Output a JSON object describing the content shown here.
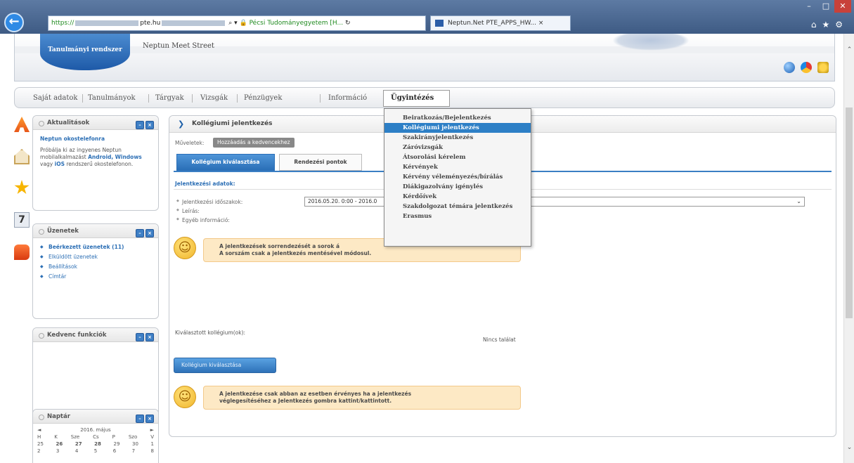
{
  "browser": {
    "address_prefix": "https://",
    "address_domain": "pte.hu",
    "address_cert": "Pécsi Tudományegyetem [H...",
    "tab_title": "Neptun.Net PTE_APPS_HW...",
    "tab_close": "×"
  },
  "header": {
    "logo_text": "Tanulmányi rendszer",
    "brand": "Neptun Meet Street"
  },
  "menu": {
    "items": [
      "Saját adatok",
      "Tanulmányok",
      "Tárgyak",
      "Vizsgák",
      "Pénzügyek",
      "Információ"
    ],
    "active": "Ügyintézés"
  },
  "dropdown": {
    "items": [
      "Beiratkozás/Bejelentkezés",
      "Kollégiumi jelentkezés",
      "Szakirányjelentkezés",
      "Záróvizsgák",
      "Átsorolási kérelem",
      "Kérvények",
      "Kérvény véleményezés/bírálás",
      "Diákigazolvány igénylés",
      "Kérdőívek",
      "Szakdolgozat témára jelentkezés",
      "Erasmus"
    ],
    "selected_index": 1
  },
  "sidebar": {
    "news": {
      "title": "Aktualitások",
      "headline": "Neptun okostelefonra",
      "body_1": "Próbálja ki az ingyenes Neptun mobilalkalmazást",
      "android": "Android,",
      "windows": "Windows",
      "body_2": "vagy",
      "ios": "iOS",
      "body_3": "rendszerű okostelefonon."
    },
    "messages": {
      "title": "Üzenetek",
      "inbox": "Beérkezett üzenetek (11)",
      "sent": "Elküldött üzenetek",
      "settings": "Beállítások",
      "contacts": "Címtár"
    },
    "favorites": {
      "title": "Kedvenc funkciók"
    },
    "calendar": {
      "title": "Naptár",
      "month": "2016. május",
      "prev": "◄",
      "next": "►",
      "weekdays": [
        "H",
        "K",
        "Sze",
        "Cs",
        "P",
        "Szo",
        "V"
      ],
      "row1": [
        "25",
        "26",
        "27",
        "28",
        "29",
        "30",
        "1"
      ],
      "row2": [
        "2",
        "3",
        "4",
        "5",
        "6",
        "7",
        "8"
      ]
    }
  },
  "main": {
    "title": "Kollégiumi jelentkezés",
    "ops_label": "Műveletek:",
    "ops_button": "Hozzáadás a kedvencekhez",
    "tab_active": "Kollégium kiválasztása",
    "tab_inactive": "Rendezési pontok",
    "section": "Jelentkezési adatok:",
    "field_period": "Jelentkezési időszakok:",
    "field_desc": "Leírás:",
    "field_info": "Egyéb információ:",
    "period_value": "2016.05.20. 0:00 - 2016.0",
    "notice_1_line1": "A jelentkezések sorrendezését a sorok á",
    "notice_1_line2": "A sorszám csak a jelentkezés mentésével módosul.",
    "selected_label": "Kiválasztott kollégium(ok):",
    "no_result": "Nincs találat",
    "apply_button": "Kollégium kiválasztása",
    "notice_2_line1": "A jelentkezése csak abban az esetben érvényes ha a jelentkezés",
    "notice_2_line2": "véglegesítéséhez a Jelentkezés gombra kattint/kattintott."
  }
}
